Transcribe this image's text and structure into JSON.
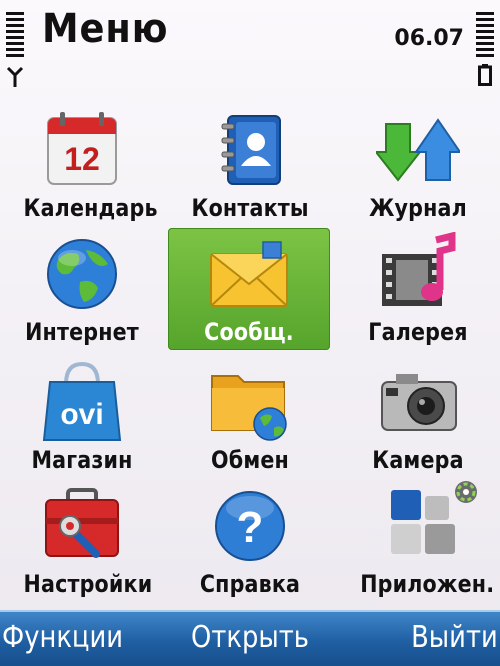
{
  "status_bar": {
    "title": "Меню",
    "time": "06.07"
  },
  "menu": {
    "items": [
      {
        "label": "Календарь",
        "icon": "calendar-icon",
        "icon_text": "12"
      },
      {
        "label": "Контакты",
        "icon": "contacts-icon"
      },
      {
        "label": "Журнал",
        "icon": "log-arrows-icon"
      },
      {
        "label": "Интернет",
        "icon": "globe-icon"
      },
      {
        "label": "Сообщ.",
        "icon": "envelope-icon",
        "selected": true
      },
      {
        "label": "Галерея",
        "icon": "gallery-music-icon"
      },
      {
        "label": "Магазин",
        "icon": "ovi-bag-icon",
        "icon_text": "ovi"
      },
      {
        "label": "Обмен",
        "icon": "folder-globe-icon"
      },
      {
        "label": "Камера",
        "icon": "camera-icon"
      },
      {
        "label": "Настройки",
        "icon": "toolbox-icon"
      },
      {
        "label": "Справка",
        "icon": "help-icon",
        "icon_text": "?"
      },
      {
        "label": "Приложен.",
        "icon": "apps-icon"
      }
    ]
  },
  "softkeys": {
    "left": "Функции",
    "middle": "Открыть",
    "right": "Выйти"
  },
  "colors": {
    "selection": "#5fae33",
    "softkey_bar": "#2a6db0"
  }
}
